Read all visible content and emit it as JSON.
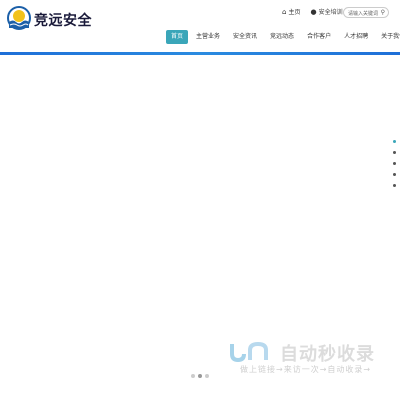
{
  "brand": {
    "name": "竞远安全",
    "logo": "sun-wave-logo"
  },
  "toplinks": [
    {
      "icon": "home-icon",
      "label": "主页"
    },
    {
      "icon": "location-icon",
      "label": "安全培训"
    }
  ],
  "search": {
    "placeholder": "请输入关键词",
    "icon": "search-icon"
  },
  "nav": [
    "首页",
    "主营业务",
    "安全资讯",
    "竞远动态",
    "合作客户",
    "人才招聘",
    "关于我们"
  ],
  "nav_active": "首页",
  "colors": {
    "accent": "#3aa6b9",
    "divider": "#1e6fd8"
  },
  "carousel": {
    "slides": 5,
    "active_slide": 1
  },
  "watermark": {
    "main": "自动秒收录",
    "sub": "做上链接→来访一次→自动收录→"
  }
}
